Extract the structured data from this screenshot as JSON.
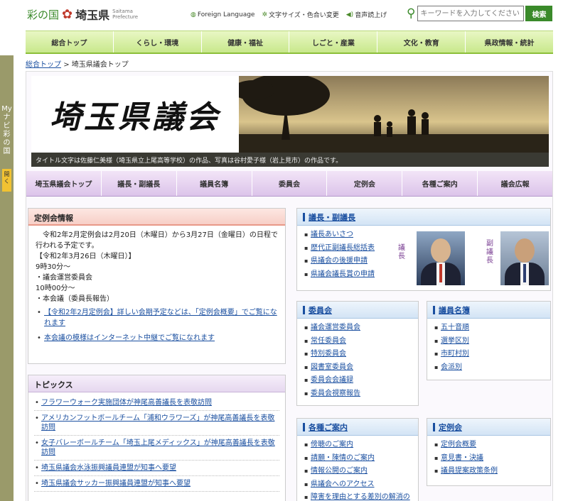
{
  "header": {
    "logo_sainokuni": "彩の国",
    "logo_pref": "埼玉県",
    "logo_romaji": "Saitama Prefecture",
    "tools": [
      {
        "icon": "globe-icon",
        "label": "Foreign Language"
      },
      {
        "icon": "gear-icon",
        "label": "文字サイズ・色合い変更"
      },
      {
        "icon": "speaker-icon",
        "label": "音声読上げ"
      }
    ],
    "search_placeholder": "キーワードを入力してください",
    "search_button": "検索"
  },
  "global_nav": [
    "総合トップ",
    "くらし・環境",
    "健康・福祉",
    "しごと・産業",
    "文化・教育",
    "県政情報・統計"
  ],
  "mynavi": {
    "label": "Myナビ 彩の国",
    "open": "開く"
  },
  "breadcrumb": {
    "link": "総合トップ",
    "separator": ">",
    "current": "埼玉県議会トップ"
  },
  "banner": {
    "title": "埼玉県議会",
    "caption": "タイトル文字は佐藤仁美様（埼玉県立上尾高等学校）の作品、写真は谷村愛子様（岩上見市）の作品です。"
  },
  "sub_nav": [
    "埼玉県議会トップ",
    "議長・副議長",
    "議員名簿",
    "委員会",
    "定例会",
    "各種ご案内",
    "議会広報"
  ],
  "teireikai": {
    "title": "定例会情報",
    "intro": "令和2年2月定例会は2月20日（木曜日）から3月27日（金曜日）の日程で行われる予定です。",
    "date": "【令和2年3月26日（木曜日）】",
    "time1": "9時30分～",
    "item1": "・議会運営委員会",
    "time2": "10時00分～",
    "item2": "・本会議（委員長報告）",
    "links": [
      "【令和2年2月定例会】詳しい会期予定などは、「定例会概要」でご覧になれます",
      "本会議の模様はインターネット中継でご覧になれます"
    ]
  },
  "topics": {
    "title": "トピックス",
    "items": [
      "フラワーウォーク実施団体が神尾高善議長を表敬訪問",
      "アメリカンフットボールチーム「浦和ウラワーズ」が神尾高善議長を表敬訪問",
      "女子バレーボールチーム「埼玉上尾メディックス」が神尾高善議長を表敬訪問",
      "埼玉県議会水泳振興議員連盟が知事へ要望",
      "埼玉県議会サッカー振興議員連盟が知事へ要望"
    ]
  },
  "gichou": {
    "title": "議長・副議長",
    "links": [
      "議長あいさつ",
      "歴代正副議長総括表",
      "県議会の後援申請",
      "県議会議長賞の申請"
    ],
    "role_chair": "議長",
    "role_vice": "副議長"
  },
  "iinkai": {
    "title": "委員会",
    "links": [
      "議会運営委員会",
      "常任委員会",
      "特別委員会",
      "図書室委員会",
      "委員会会議録",
      "委員会視察報告"
    ]
  },
  "meibo": {
    "title": "議員名簿",
    "links": [
      "五十音順",
      "選挙区別",
      "市町村別",
      "会派別"
    ]
  },
  "annai": {
    "title": "各種ご案内",
    "links": [
      "傍聴のご案内",
      "請願・陳情のご案内",
      "情報公開のご案内",
      "県議会へのアクセス",
      "障害を理由とする差別の解消の"
    ]
  },
  "teireikai_side": {
    "title": "定例会",
    "links": [
      "定例会概要",
      "意見書・決議",
      "議員提案政策条例"
    ]
  },
  "colors": {
    "green_accent": "#3a8a2a",
    "link_blue": "#1a4fa0",
    "purple_nav": "#dcc4ea",
    "pink_header": "#f7cfc7"
  }
}
